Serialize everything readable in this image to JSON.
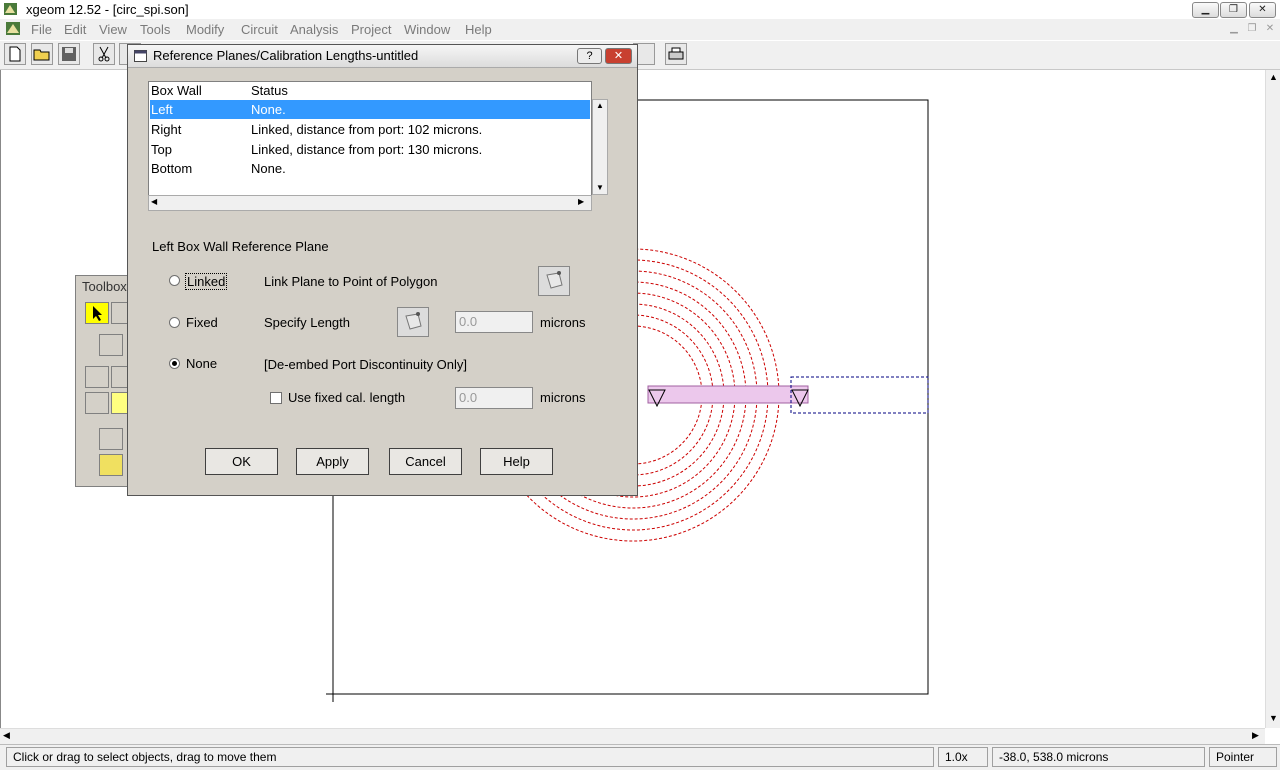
{
  "app": {
    "title": "xgeom 12.52 - [circ_spi.son]"
  },
  "menu": [
    "File",
    "Edit",
    "View",
    "Tools",
    "Modify",
    "Circuit",
    "Analysis",
    "Project",
    "Window",
    "Help"
  ],
  "toolbox": {
    "title": "Toolbox"
  },
  "dialog": {
    "title": "Reference Planes/Calibration Lengths-untitled",
    "help_glyph": "?",
    "close_glyph": "✕",
    "list": {
      "headers": [
        "Box Wall",
        "Status"
      ],
      "rows": [
        {
          "wall": "Left",
          "status": "None."
        },
        {
          "wall": "Right",
          "status": "Linked, distance from port: 102 microns."
        },
        {
          "wall": "Top",
          "status": "Linked, distance from port: 130 microns."
        },
        {
          "wall": "Bottom",
          "status": "None."
        }
      ],
      "selected_row": "Left"
    },
    "section_title": "Left Box Wall Reference Plane",
    "options": {
      "linked": {
        "label": "Linked",
        "desc": "Link Plane to Point of Polygon"
      },
      "fixed": {
        "label": "Fixed",
        "desc": "Specify Length",
        "value": "0.0",
        "unit": "microns"
      },
      "none": {
        "label": "None",
        "desc": "[De-embed Port Discontinuity Only]"
      }
    },
    "selected_option": "None",
    "use_fixed": {
      "label": "Use fixed cal. length",
      "value": "0.0",
      "unit": "microns",
      "checked": false
    },
    "buttons": {
      "ok": "OK",
      "apply": "Apply",
      "cancel": "Cancel",
      "help": "Help"
    }
  },
  "status": {
    "message": "Click or drag to select objects, drag to move them",
    "zoom": "1.0x",
    "coords": "-38.0, 538.0 microns",
    "mode": "Pointer"
  },
  "colors": {
    "selection": "#3399ff",
    "circle": "#cc0000",
    "strip": "#d8a0d8"
  }
}
